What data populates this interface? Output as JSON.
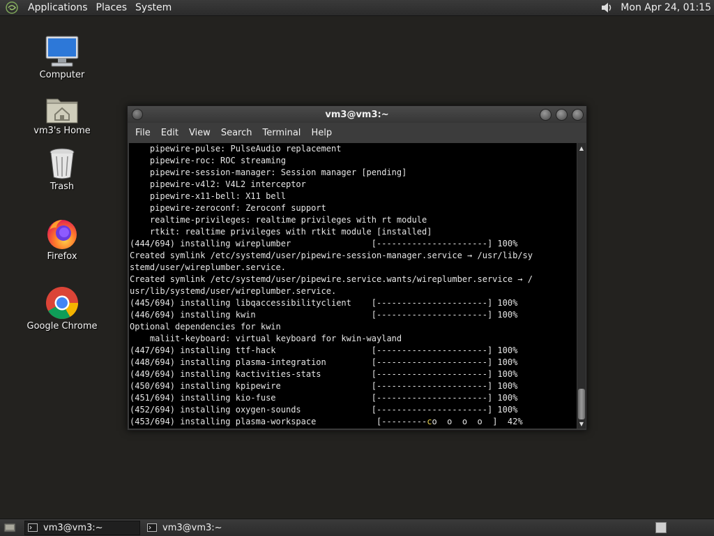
{
  "top_panel": {
    "menus": [
      "Applications",
      "Places",
      "System"
    ],
    "clock": "Mon Apr 24, 01:15"
  },
  "desktop": {
    "icons": [
      {
        "label": "Computer",
        "icon": "computer-icon"
      },
      {
        "label": "vm3's Home",
        "icon": "home-folder-icon"
      },
      {
        "label": "Trash",
        "icon": "trash-icon"
      },
      {
        "label": "Firefox",
        "icon": "firefox-icon"
      },
      {
        "label": "Google Chrome",
        "icon": "chrome-icon"
      }
    ]
  },
  "terminal": {
    "title": "vm3@vm3:~",
    "menu": [
      "File",
      "Edit",
      "View",
      "Search",
      "Terminal",
      "Help"
    ],
    "lines": [
      "    pipewire-pulse: PulseAudio replacement",
      "    pipewire-roc: ROC streaming",
      "    pipewire-session-manager: Session manager [pending]",
      "    pipewire-v4l2: V4L2 interceptor",
      "    pipewire-x11-bell: X11 bell",
      "    pipewire-zeroconf: Zeroconf support",
      "    realtime-privileges: realtime privileges with rt module",
      "    rtkit: realtime privileges with rtkit module [installed]",
      "(444/694) installing wireplumber                [----------------------] 100%",
      "Created symlink /etc/systemd/user/pipewire-session-manager.service → /usr/lib/sy",
      "stemd/user/wireplumber.service.",
      "Created symlink /etc/systemd/user/pipewire.service.wants/wireplumber.service → /",
      "usr/lib/systemd/user/wireplumber.service.",
      "(445/694) installing libqaccessibilityclient    [----------------------] 100%",
      "(446/694) installing kwin                       [----------------------] 100%",
      "Optional dependencies for kwin",
      "    maliit-keyboard: virtual keyboard for kwin-wayland",
      "(447/694) installing ttf-hack                   [----------------------] 100%",
      "(448/694) installing plasma-integration         [----------------------] 100%",
      "(449/694) installing kactivities-stats          [----------------------] 100%",
      "(450/694) installing kpipewire                  [----------------------] 100%",
      "(451/694) installing kio-fuse                   [----------------------] 100%",
      "(452/694) installing oxygen-sounds              [----------------------] 100%"
    ],
    "last_line_prefix": "(453/694) installing plasma-workspace            [---------",
    "last_line_cursor": "c",
    "last_line_suffix": "o  o  o  o  ]  42%"
  },
  "bottom_panel": {
    "tasks": [
      {
        "label": "vm3@vm3:~",
        "active": true
      },
      {
        "label": "vm3@vm3:~",
        "active": false
      }
    ]
  },
  "colors": {
    "desktop_bg": "#23221f",
    "panel_bg": "#2f2f2f",
    "terminal_bg": "#000000",
    "terminal_fg": "#e6e6e6",
    "cursor": "#e8d24a"
  }
}
